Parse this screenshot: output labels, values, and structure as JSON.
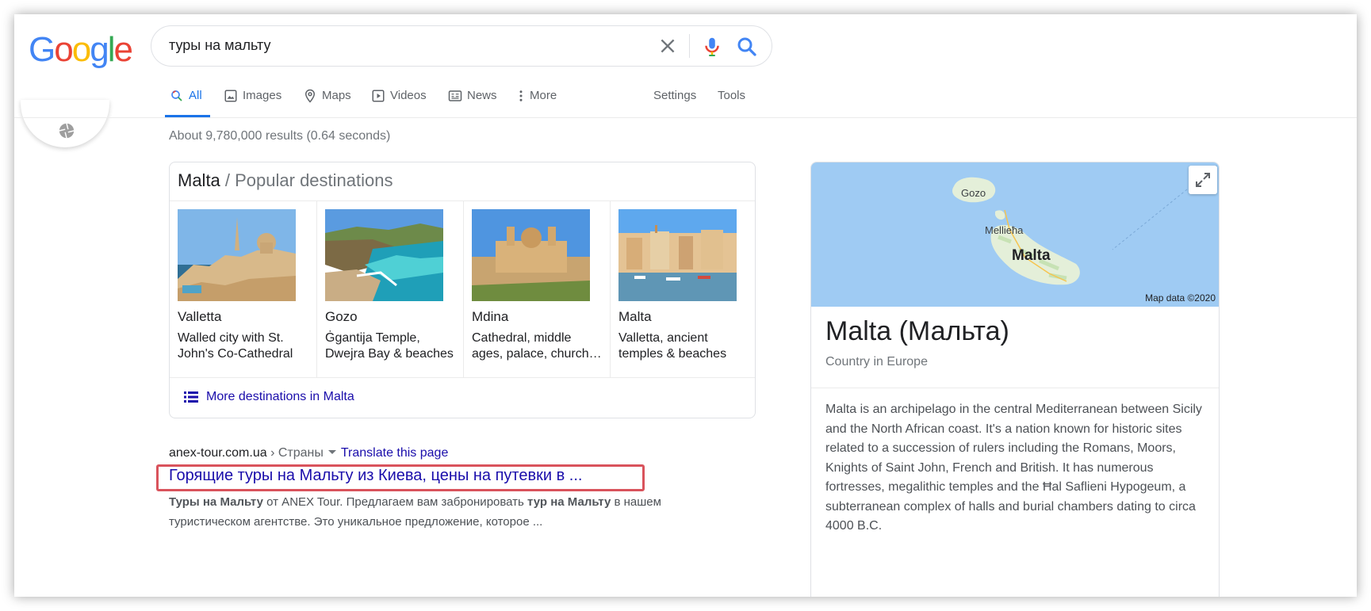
{
  "search": {
    "query": "туры на мальту"
  },
  "logo": [
    "G",
    "o",
    "o",
    "g",
    "l",
    "e"
  ],
  "tabs": {
    "all": "All",
    "images": "Images",
    "maps": "Maps",
    "videos": "Videos",
    "news": "News",
    "more": "More",
    "settings": "Settings",
    "tools": "Tools"
  },
  "stats": "About 9,780,000 results (0.64 seconds)",
  "destinations": {
    "title_main": "Malta",
    "title_sub": " / Popular destinations",
    "items": [
      {
        "name": "Valletta",
        "desc": "Walled city with St. John's Co-Cathedral"
      },
      {
        "name": "Gozo",
        "desc": "Ġgantija Temple, Dwejra Bay & beaches"
      },
      {
        "name": "Mdina",
        "desc": "Cathedral, middle ages, palace, church…"
      },
      {
        "name": "Malta",
        "desc": "Valletta, ancient temples & beaches"
      }
    ],
    "more_link": "More destinations in Malta"
  },
  "result": {
    "domain": "anex-tour.com.ua",
    "crumb": " › Страны",
    "translate": "Translate this page",
    "title": "Горящие туры на Мальту из Киева, цены на путевки в ...",
    "snippet_b1": "Туры на Мальту",
    "snippet_t1": " от ANEX Tour. Предлагаем вам забронировать ",
    "snippet_b2": "тур на Мальту",
    "snippet_t2": " в нашем туристическом агентстве. Это уникальное предложение, которое ..."
  },
  "knowledge_panel": {
    "map_labels": {
      "gozo": "Gozo",
      "mellieha": "Mellieħa",
      "malta": "Malta"
    },
    "map_credit": "Map data ©2020",
    "title": "Malta (Мальта)",
    "subtitle": "Country in Europe",
    "description": "Malta is an archipelago in the central Mediterranean between Sicily and the North African coast. It's a nation known for historic sites related to a succession of rulers including the Romans, Moors, Knights of Saint John, French and British. It has numerous fortresses, megalithic temples and the Ħal Saflieni Hypogeum, a subterranean complex of halls and burial chambers dating to circa 4000 B.C."
  },
  "colors": {
    "link": "#1a0dab",
    "accent": "#1a73e8",
    "highlight_box": "#d9535c",
    "map_sea": "#9fcbf3"
  }
}
